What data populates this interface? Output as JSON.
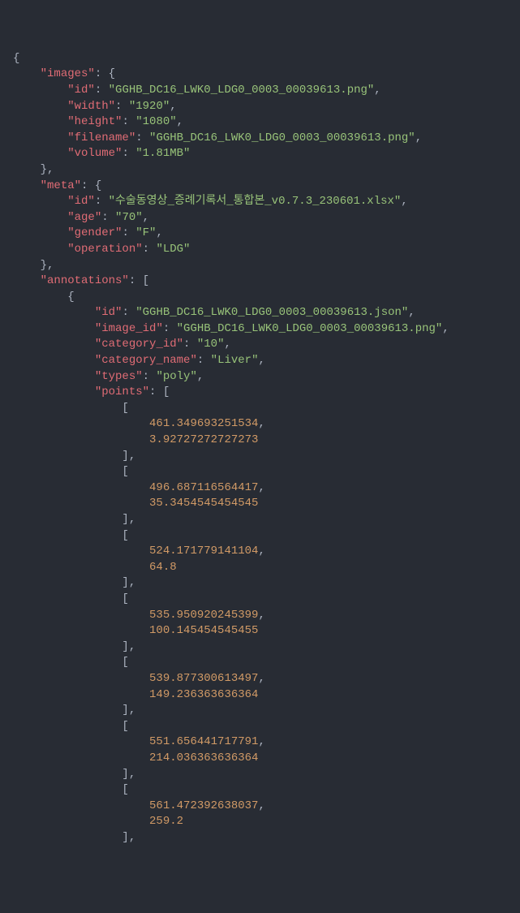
{
  "lines": [
    [
      [
        "punct",
        "{"
      ]
    ],
    [
      [
        "punct",
        "    "
      ],
      [
        "key",
        "\"images\""
      ],
      [
        "punct",
        ": {"
      ]
    ],
    [
      [
        "punct",
        "        "
      ],
      [
        "key",
        "\"id\""
      ],
      [
        "punct",
        ": "
      ],
      [
        "string",
        "\"GGHB_DC16_LWK0_LDG0_0003_00039613.png\""
      ],
      [
        "punct",
        ","
      ]
    ],
    [
      [
        "punct",
        "        "
      ],
      [
        "key",
        "\"width\""
      ],
      [
        "punct",
        ": "
      ],
      [
        "string",
        "\"1920\""
      ],
      [
        "punct",
        ","
      ]
    ],
    [
      [
        "punct",
        "        "
      ],
      [
        "key",
        "\"height\""
      ],
      [
        "punct",
        ": "
      ],
      [
        "string",
        "\"1080\""
      ],
      [
        "punct",
        ","
      ]
    ],
    [
      [
        "punct",
        "        "
      ],
      [
        "key",
        "\"filename\""
      ],
      [
        "punct",
        ": "
      ],
      [
        "string",
        "\"GGHB_DC16_LWK0_LDG0_0003_00039613.png\""
      ],
      [
        "punct",
        ","
      ]
    ],
    [
      [
        "punct",
        "        "
      ],
      [
        "key",
        "\"volume\""
      ],
      [
        "punct",
        ": "
      ],
      [
        "string",
        "\"1.81MB\""
      ]
    ],
    [
      [
        "punct",
        "    },"
      ]
    ],
    [
      [
        "punct",
        "    "
      ],
      [
        "key",
        "\"meta\""
      ],
      [
        "punct",
        ": {"
      ]
    ],
    [
      [
        "punct",
        "        "
      ],
      [
        "key",
        "\"id\""
      ],
      [
        "punct",
        ": "
      ],
      [
        "string",
        "\"수술동영상_증례기록서_통합본_v0.7.3_230601.xlsx\""
      ],
      [
        "punct",
        ","
      ]
    ],
    [
      [
        "punct",
        "        "
      ],
      [
        "key",
        "\"age\""
      ],
      [
        "punct",
        ": "
      ],
      [
        "string",
        "\"70\""
      ],
      [
        "punct",
        ","
      ]
    ],
    [
      [
        "punct",
        "        "
      ],
      [
        "key",
        "\"gender\""
      ],
      [
        "punct",
        ": "
      ],
      [
        "string",
        "\"F\""
      ],
      [
        "punct",
        ","
      ]
    ],
    [
      [
        "punct",
        "        "
      ],
      [
        "key",
        "\"operation\""
      ],
      [
        "punct",
        ": "
      ],
      [
        "string",
        "\"LDG\""
      ]
    ],
    [
      [
        "punct",
        "    },"
      ]
    ],
    [
      [
        "punct",
        "    "
      ],
      [
        "key",
        "\"annotations\""
      ],
      [
        "punct",
        ": ["
      ]
    ],
    [
      [
        "punct",
        "        {"
      ]
    ],
    [
      [
        "punct",
        "            "
      ],
      [
        "key",
        "\"id\""
      ],
      [
        "punct",
        ": "
      ],
      [
        "string",
        "\"GGHB_DC16_LWK0_LDG0_0003_00039613.json\""
      ],
      [
        "punct",
        ","
      ]
    ],
    [
      [
        "punct",
        "            "
      ],
      [
        "key",
        "\"image_id\""
      ],
      [
        "punct",
        ": "
      ],
      [
        "string",
        "\"GGHB_DC16_LWK0_LDG0_0003_00039613.png\""
      ],
      [
        "punct",
        ","
      ]
    ],
    [
      [
        "punct",
        "            "
      ],
      [
        "key",
        "\"category_id\""
      ],
      [
        "punct",
        ": "
      ],
      [
        "string",
        "\"10\""
      ],
      [
        "punct",
        ","
      ]
    ],
    [
      [
        "punct",
        "            "
      ],
      [
        "key",
        "\"category_name\""
      ],
      [
        "punct",
        ": "
      ],
      [
        "string",
        "\"Liver\""
      ],
      [
        "punct",
        ","
      ]
    ],
    [
      [
        "punct",
        "            "
      ],
      [
        "key",
        "\"types\""
      ],
      [
        "punct",
        ": "
      ],
      [
        "string",
        "\"poly\""
      ],
      [
        "punct",
        ","
      ]
    ],
    [
      [
        "punct",
        "            "
      ],
      [
        "key",
        "\"points\""
      ],
      [
        "punct",
        ": ["
      ]
    ],
    [
      [
        "punct",
        "                ["
      ]
    ],
    [
      [
        "punct",
        "                    "
      ],
      [
        "orange",
        "461.349693251534"
      ],
      [
        "punct",
        ","
      ]
    ],
    [
      [
        "punct",
        "                    "
      ],
      [
        "orange",
        "3.92727272727273"
      ]
    ],
    [
      [
        "punct",
        "                ],"
      ]
    ],
    [
      [
        "punct",
        "                ["
      ]
    ],
    [
      [
        "punct",
        "                    "
      ],
      [
        "orange",
        "496.687116564417"
      ],
      [
        "punct",
        ","
      ]
    ],
    [
      [
        "punct",
        "                    "
      ],
      [
        "orange",
        "35.3454545454545"
      ]
    ],
    [
      [
        "punct",
        "                ],"
      ]
    ],
    [
      [
        "punct",
        "                ["
      ]
    ],
    [
      [
        "punct",
        "                    "
      ],
      [
        "orange",
        "524.171779141104"
      ],
      [
        "punct",
        ","
      ]
    ],
    [
      [
        "punct",
        "                    "
      ],
      [
        "orange",
        "64.8"
      ]
    ],
    [
      [
        "punct",
        "                ],"
      ]
    ],
    [
      [
        "punct",
        "                ["
      ]
    ],
    [
      [
        "punct",
        "                    "
      ],
      [
        "orange",
        "535.950920245399"
      ],
      [
        "punct",
        ","
      ]
    ],
    [
      [
        "punct",
        "                    "
      ],
      [
        "orange",
        "100.145454545455"
      ]
    ],
    [
      [
        "punct",
        "                ],"
      ]
    ],
    [
      [
        "punct",
        "                ["
      ]
    ],
    [
      [
        "punct",
        "                    "
      ],
      [
        "orange",
        "539.877300613497"
      ],
      [
        "punct",
        ","
      ]
    ],
    [
      [
        "punct",
        "                    "
      ],
      [
        "orange",
        "149.236363636364"
      ]
    ],
    [
      [
        "punct",
        "                ],"
      ]
    ],
    [
      [
        "punct",
        "                ["
      ]
    ],
    [
      [
        "punct",
        "                    "
      ],
      [
        "orange",
        "551.656441717791"
      ],
      [
        "punct",
        ","
      ]
    ],
    [
      [
        "punct",
        "                    "
      ],
      [
        "orange",
        "214.036363636364"
      ]
    ],
    [
      [
        "punct",
        "                ],"
      ]
    ],
    [
      [
        "punct",
        "                ["
      ]
    ],
    [
      [
        "punct",
        "                    "
      ],
      [
        "orange",
        "561.472392638037"
      ],
      [
        "punct",
        ","
      ]
    ],
    [
      [
        "punct",
        "                    "
      ],
      [
        "orange",
        "259.2"
      ]
    ],
    [
      [
        "punct",
        "                ],"
      ]
    ]
  ]
}
